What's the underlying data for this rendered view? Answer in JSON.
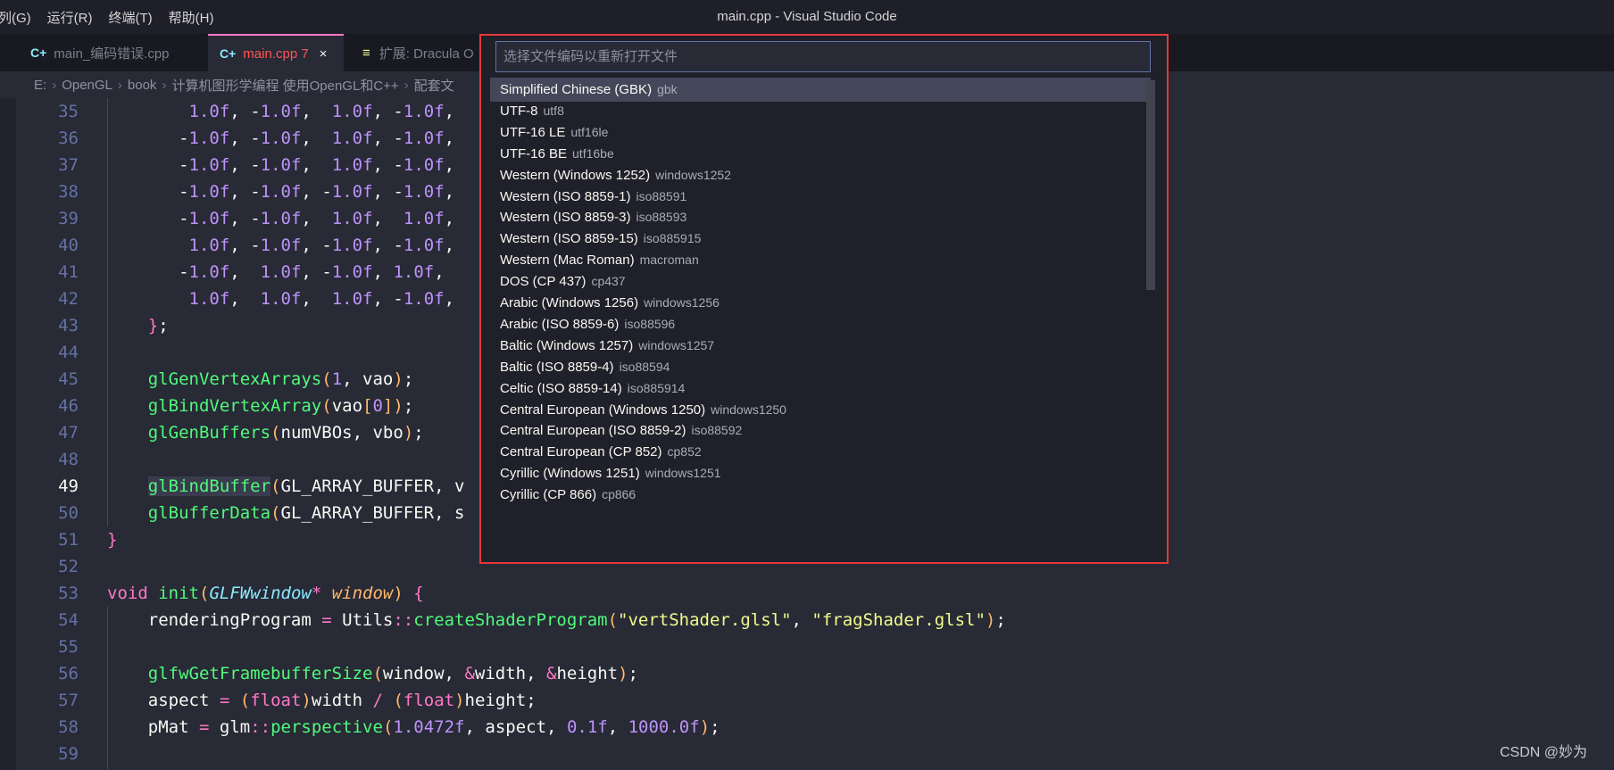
{
  "titlebar": {
    "menu": [
      "列(G)",
      "运行(R)",
      "终端(T)",
      "帮助(H)"
    ],
    "window_title": "main.cpp - Visual Studio Code"
  },
  "tabs": [
    {
      "icon": "C+",
      "label": "main_编码错误.cpp",
      "active": false
    },
    {
      "icon": "C+",
      "label": "main.cpp 7",
      "active": true,
      "close": "×"
    },
    {
      "icon": "≡",
      "label": "扩展: Dracula O",
      "active": false
    }
  ],
  "breadcrumbs": [
    "E:",
    "OpenGL",
    "book",
    "计算机图形学编程 使用OpenGL和C++",
    "配套文"
  ],
  "editor": {
    "line_numbers": [
      "35",
      "36",
      "37",
      "38",
      "39",
      "40",
      "41",
      "42",
      "43",
      "44",
      "45",
      "46",
      "47",
      "48",
      "49",
      "50",
      "51",
      "52",
      "53",
      "54",
      "55",
      "56",
      "57",
      "58",
      "59"
    ],
    "current_line": "49",
    "lines": [
      "        1.0f, -1.0f,  1.0f, -1.0f,",
      "       -1.0f, -1.0f,  1.0f, -1.0f,",
      "       -1.0f, -1.0f,  1.0f, -1.0f,",
      "       -1.0f, -1.0f, -1.0f, -1.0f,",
      "       -1.0f, -1.0f,  1.0f,  1.0f,",
      "        1.0f, -1.0f, -1.0f, -1.0f,",
      "       -1.0f,  1.0f, -1.0f, 1.0f,",
      "        1.0f,  1.0f,  1.0f, -1.0f,",
      "    };",
      "",
      "    glGenVertexArrays(1, vao);",
      "    glBindVertexArray(vao[0]);",
      "    glGenBuffers(numVBOs, vbo);",
      "",
      "    glBindBuffer(GL_ARRAY_BUFFER, v",
      "    glBufferData(GL_ARRAY_BUFFER, s",
      "}",
      "",
      "void init(GLFWwindow* window) {",
      "    renderingProgram = Utils::createShaderProgram(\"vertShader.glsl\", \"fragShader.glsl\");",
      "",
      "    glfwGetFramebufferSize(window, &width, &height);",
      "    aspect = (float)width / (float)height;",
      "    pMat = glm::perspective(1.0472f, aspect, 0.1f, 1000.0f);",
      ""
    ]
  },
  "quick_pick": {
    "placeholder": "选择文件编码以重新打开文件",
    "items": [
      {
        "label": "Simplified Chinese (GBK)",
        "desc": "gbk"
      },
      {
        "label": "UTF-8",
        "desc": "utf8"
      },
      {
        "label": "UTF-16 LE",
        "desc": "utf16le"
      },
      {
        "label": "UTF-16 BE",
        "desc": "utf16be"
      },
      {
        "label": "Western (Windows 1252)",
        "desc": "windows1252"
      },
      {
        "label": "Western (ISO 8859-1)",
        "desc": "iso88591"
      },
      {
        "label": "Western (ISO 8859-3)",
        "desc": "iso88593"
      },
      {
        "label": "Western (ISO 8859-15)",
        "desc": "iso885915"
      },
      {
        "label": "Western (Mac Roman)",
        "desc": "macroman"
      },
      {
        "label": "DOS (CP 437)",
        "desc": "cp437"
      },
      {
        "label": "Arabic (Windows 1256)",
        "desc": "windows1256"
      },
      {
        "label": "Arabic (ISO 8859-6)",
        "desc": "iso88596"
      },
      {
        "label": "Baltic (Windows 1257)",
        "desc": "windows1257"
      },
      {
        "label": "Baltic (ISO 8859-4)",
        "desc": "iso88594"
      },
      {
        "label": "Celtic (ISO 8859-14)",
        "desc": "iso885914"
      },
      {
        "label": "Central European (Windows 1250)",
        "desc": "windows1250"
      },
      {
        "label": "Central European (ISO 8859-2)",
        "desc": "iso88592"
      },
      {
        "label": "Central European (CP 852)",
        "desc": "cp852"
      },
      {
        "label": "Cyrillic (Windows 1251)",
        "desc": "windows1251"
      },
      {
        "label": "Cyrillic (CP 866)",
        "desc": "cp866"
      }
    ],
    "selected_index": 0,
    "highlight_border_color": "#e5383b"
  },
  "watermark": "CSDN @妙为",
  "colors": {
    "editor_bg": "#282a36",
    "numeric": "#bd93f9",
    "function": "#50fa7b",
    "keyword": "#ff79c6",
    "string": "#f1fa8c"
  }
}
